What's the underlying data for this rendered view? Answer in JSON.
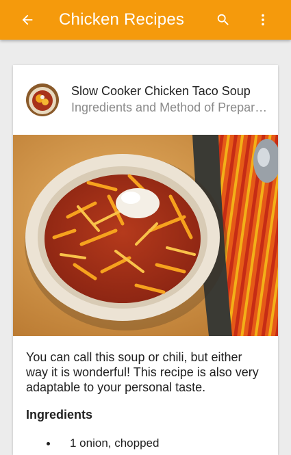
{
  "appbar": {
    "title": "Chicken Recipes",
    "background": "#f59a0c",
    "icons": [
      "arrow-back-icon",
      "search-icon",
      "more-vertical-icon"
    ]
  },
  "card": {
    "title": "Slow Cooker Chicken Taco Soup",
    "subtitle": "Ingredients and Method of Preparation",
    "intro": "You can call this soup or chili, but either way it is wonderful! This recipe is also very adaptable to your personal taste.",
    "section_heading": "Ingredients",
    "ingredients": [
      "1 onion, chopped"
    ]
  }
}
